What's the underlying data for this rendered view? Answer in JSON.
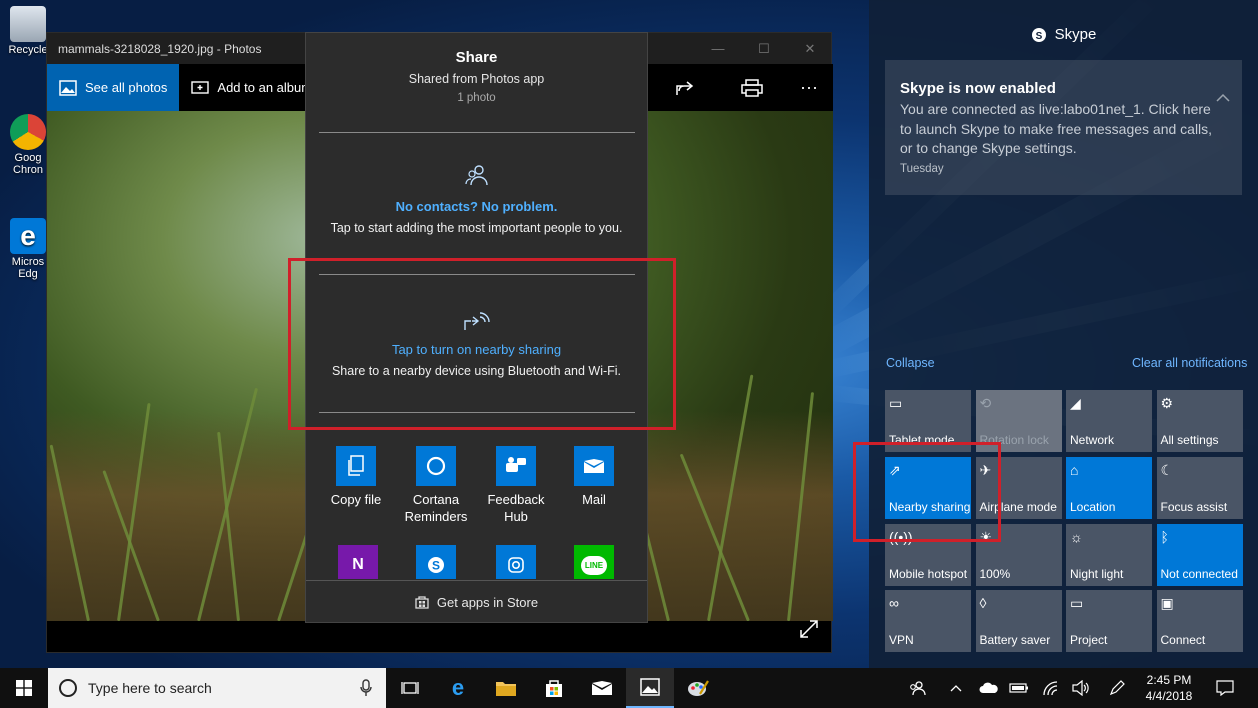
{
  "desktop": {
    "icons": [
      {
        "label": "Recycle",
        "icon": "recycle-bin-icon"
      },
      {
        "label": "Goog\nChron",
        "icon": "chrome-icon"
      },
      {
        "label": "Micros\nEdg",
        "icon": "edge-icon"
      }
    ]
  },
  "photos_window": {
    "title": "mammals-3218028_1920.jpg - Photos",
    "see_all_label": "See all photos",
    "add_album_label": "Add to an album",
    "minimize": "—",
    "maximize": "☐",
    "close": "✕"
  },
  "share_panel": {
    "title": "Share",
    "subtitle": "Shared from Photos app",
    "count": "1 photo",
    "no_contacts_title": "No contacts? No problem.",
    "no_contacts_desc": "Tap to start adding the most important people to you.",
    "nearby_title": "Tap to turn on nearby sharing",
    "nearby_desc": "Share to a nearby device using Bluetooth and Wi-Fi.",
    "apps": [
      {
        "label": "Copy file",
        "icon": "copy-file-icon",
        "color": "#0078d7"
      },
      {
        "label": "Cortana\nReminders",
        "icon": "cortana-icon",
        "color": "#0078d7"
      },
      {
        "label": "Feedback\nHub",
        "icon": "feedback-hub-icon",
        "color": "#0078d7"
      },
      {
        "label": "Mail",
        "icon": "mail-icon",
        "color": "#0078d7"
      }
    ],
    "apps_row2": [
      {
        "icon": "onenote-icon",
        "color": "#7719aa"
      },
      {
        "icon": "skype-icon",
        "color": "#0078d7"
      },
      {
        "icon": "instagram-icon",
        "color": "#0078d7"
      },
      {
        "icon": "line-icon",
        "color": "#00b900"
      }
    ],
    "line_label": "LINE",
    "onenote_label": "N",
    "store_label": "Get apps in Store"
  },
  "action_center": {
    "header": "Skype",
    "notification": {
      "title": "Skype is now enabled",
      "body": "You are connected as live:labo01net_1. Click here to launch Skype to make free messages and calls, or to change Skype settings.",
      "time": "Tuesday"
    },
    "collapse": "Collapse",
    "clear_all": "Clear all notifications",
    "quick_actions": [
      {
        "label": "Tablet mode",
        "icon": "tablet-mode-icon",
        "state": "off"
      },
      {
        "label": "Rotation lock",
        "icon": "rotation-lock-icon",
        "state": "disabled"
      },
      {
        "label": "Network",
        "icon": "network-icon",
        "state": "off"
      },
      {
        "label": "All settings",
        "icon": "gear-icon",
        "state": "off"
      },
      {
        "label": "Nearby sharing",
        "icon": "nearby-sharing-icon",
        "state": "on"
      },
      {
        "label": "Airplane mode",
        "icon": "airplane-icon",
        "state": "off"
      },
      {
        "label": "Location",
        "icon": "location-icon",
        "state": "on"
      },
      {
        "label": "Focus assist",
        "icon": "moon-icon",
        "state": "off"
      },
      {
        "label": "Mobile hotspot",
        "icon": "hotspot-icon",
        "state": "off"
      },
      {
        "label": "100%",
        "icon": "brightness-icon",
        "state": "off"
      },
      {
        "label": "Night light",
        "icon": "night-light-icon",
        "state": "off"
      },
      {
        "label": "Not connected",
        "icon": "bluetooth-icon",
        "state": "on"
      },
      {
        "label": "VPN",
        "icon": "vpn-icon",
        "state": "off"
      },
      {
        "label": "Battery saver",
        "icon": "battery-saver-icon",
        "state": "off"
      },
      {
        "label": "Project",
        "icon": "project-icon",
        "state": "off"
      },
      {
        "label": "Connect",
        "icon": "connect-icon",
        "state": "off"
      }
    ]
  },
  "taskbar": {
    "search_placeholder": "Type here to search",
    "time": "2:45 PM",
    "date": "4/4/2018"
  },
  "colors": {
    "accent": "#0078d7",
    "highlight_box": "#d0202a",
    "link": "#4fb0ff"
  }
}
